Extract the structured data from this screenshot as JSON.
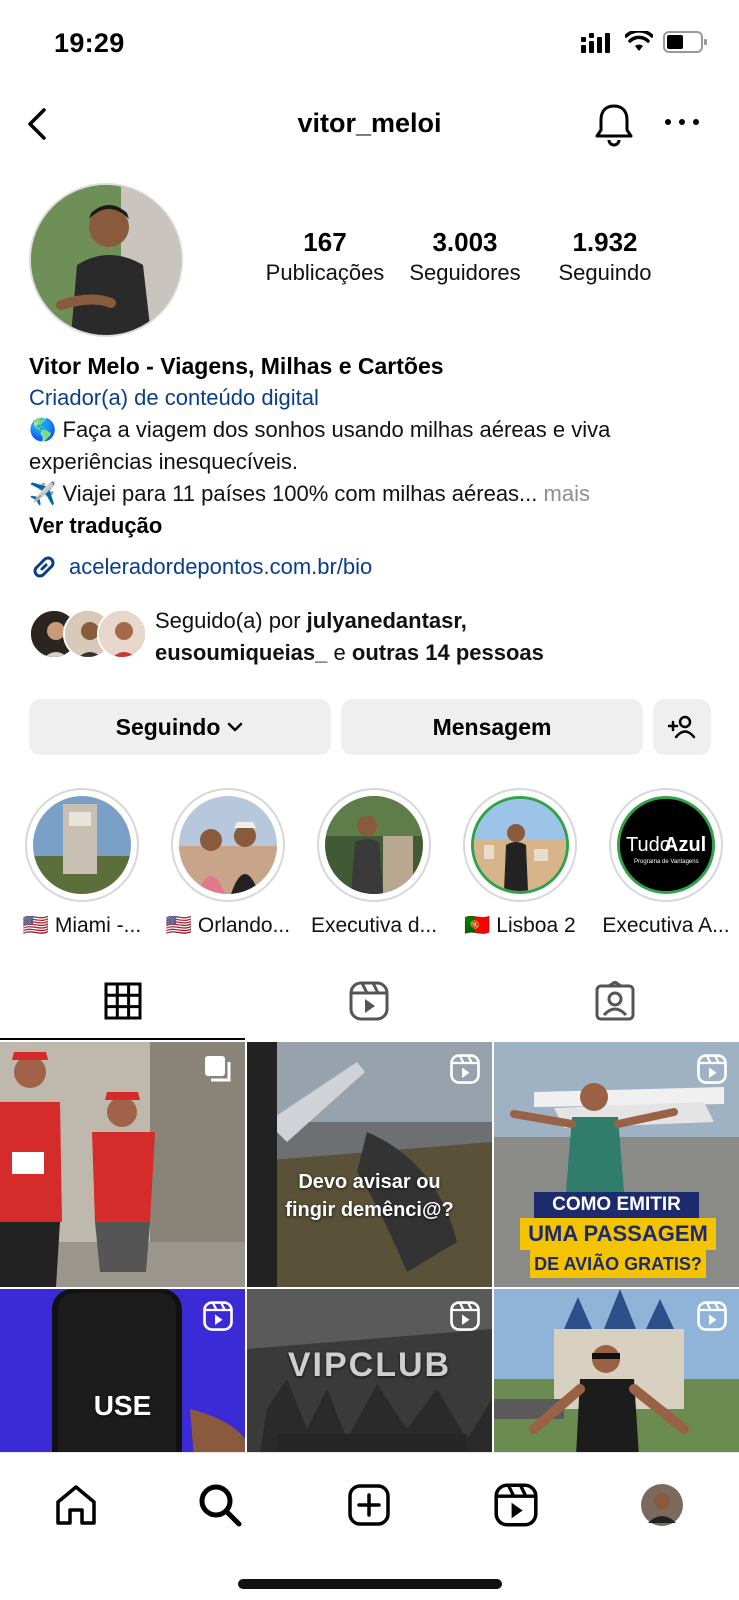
{
  "status_bar": {
    "time": "19:29",
    "icons": [
      "signal-icon",
      "wifi-icon",
      "battery-icon"
    ]
  },
  "header": {
    "username": "vitor_meloi",
    "icons": [
      "back-arrow-icon",
      "bell-icon",
      "more-icon"
    ]
  },
  "stats": [
    {
      "value": "167",
      "label": "Publicações"
    },
    {
      "value": "3.003",
      "label": "Seguidores"
    },
    {
      "value": "1.932",
      "label": "Seguindo"
    }
  ],
  "bio": {
    "name": "Vitor Melo - Viagens, Milhas e Cartões",
    "category": "Criador(a) de conteúdo digital",
    "line1": "🌎 Faça a viagem dos sonhos usando milhas aéreas e viva",
    "line2": "experiências inesquecíveis.",
    "line3": "✈️ Viajei para 11 países 100% com milhas aéreas...",
    "more": "mais",
    "translate": "Ver tradução",
    "link": "aceleradordepontos.com.br/bio"
  },
  "followed_by": {
    "prefix": "Seguido(a) por",
    "user1": "julyanedantasr,",
    "user2": "eusoumiqueias_",
    "conj": "e",
    "others": "outras 14 pessoas"
  },
  "actions": {
    "following_label": "Seguindo",
    "message_label": "Mensagem"
  },
  "highlights": [
    {
      "label": "🇺🇸 Miami -..."
    },
    {
      "label": "🇺🇸 Orlando..."
    },
    {
      "label": "Executiva d..."
    },
    {
      "label": "🇵🇹 Lisboa 2"
    },
    {
      "label": "Executiva A...",
      "logo_text_1": "Tudo",
      "logo_text_2": "Azul",
      "logo_sub": "Programa de Vantagens"
    }
  ],
  "tabs": [
    "grid-tab",
    "reels-tab",
    "tagged-tab"
  ],
  "posts": [
    {
      "type": "carousel",
      "caption": ""
    },
    {
      "type": "reel",
      "caption": "Devo avisar ou fingir demênci@?"
    },
    {
      "type": "reel",
      "caption_line1": "COMO EMITIR",
      "caption_line2": "UMA PASSAGEM",
      "caption_line3": "DE AVIÃO GRATIS?"
    },
    {
      "type": "reel",
      "caption": "USE"
    },
    {
      "type": "reel",
      "caption": "VIPCLUB"
    },
    {
      "type": "reel",
      "caption": ""
    }
  ],
  "bottom_nav": [
    "home-icon",
    "search-icon",
    "create-icon",
    "reels-icon",
    "profile-avatar"
  ],
  "colors": {
    "link_blue": "#0a3e8a",
    "button_gray": "#efefef",
    "yellow_banner": "#f5c400",
    "purple": "#3b2bd6"
  }
}
